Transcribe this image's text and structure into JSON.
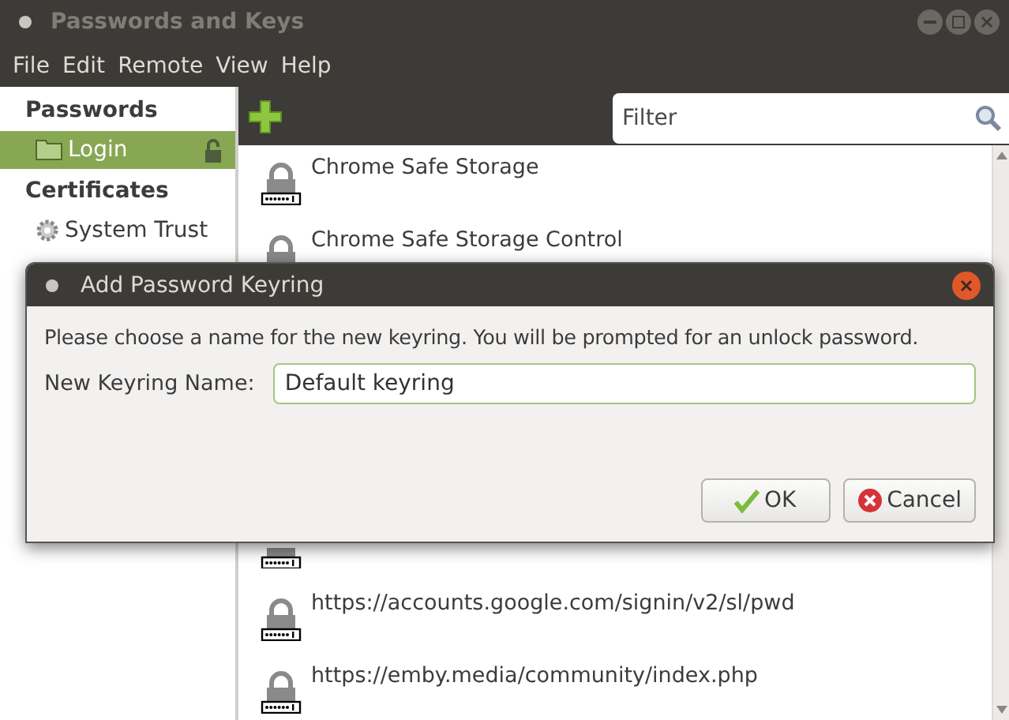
{
  "window": {
    "title": "Passwords and Keys",
    "focused": false
  },
  "menu": [
    "File",
    "Edit",
    "Remote",
    "View",
    "Help"
  ],
  "sidebar": {
    "sections": [
      {
        "title": "Passwords",
        "items": [
          {
            "label": "Login",
            "kind": "keyring",
            "selected": true,
            "locked": false
          }
        ]
      },
      {
        "title": "Certificates",
        "items": [
          {
            "label": "System Trust",
            "kind": "trust",
            "selected": false
          }
        ]
      }
    ]
  },
  "filter": {
    "placeholder": "Filter"
  },
  "items": [
    {
      "kind": "entry",
      "label": "Chrome Safe Storage"
    },
    {
      "kind": "entry",
      "label": "Chrome Safe Storage Control"
    },
    {
      "kind": "gap"
    },
    {
      "kind": "gap"
    },
    {
      "kind": "gap"
    },
    {
      "kind": "icon-only"
    },
    {
      "kind": "entry",
      "label": "https://accounts.google.com/signin/v2/sl/pwd"
    },
    {
      "kind": "entry",
      "label": "https://emby.media/community/index.php"
    }
  ],
  "dialog": {
    "title": "Add Password Keyring",
    "message": "Please choose a name for the new keyring. You will be prompted for an unlock password.",
    "field_label": "New Keyring Name:",
    "field_value": "Default keyring",
    "buttons": [
      {
        "label": "OK",
        "kind": "ok"
      },
      {
        "label": "Cancel",
        "kind": "cancel"
      }
    ]
  }
}
